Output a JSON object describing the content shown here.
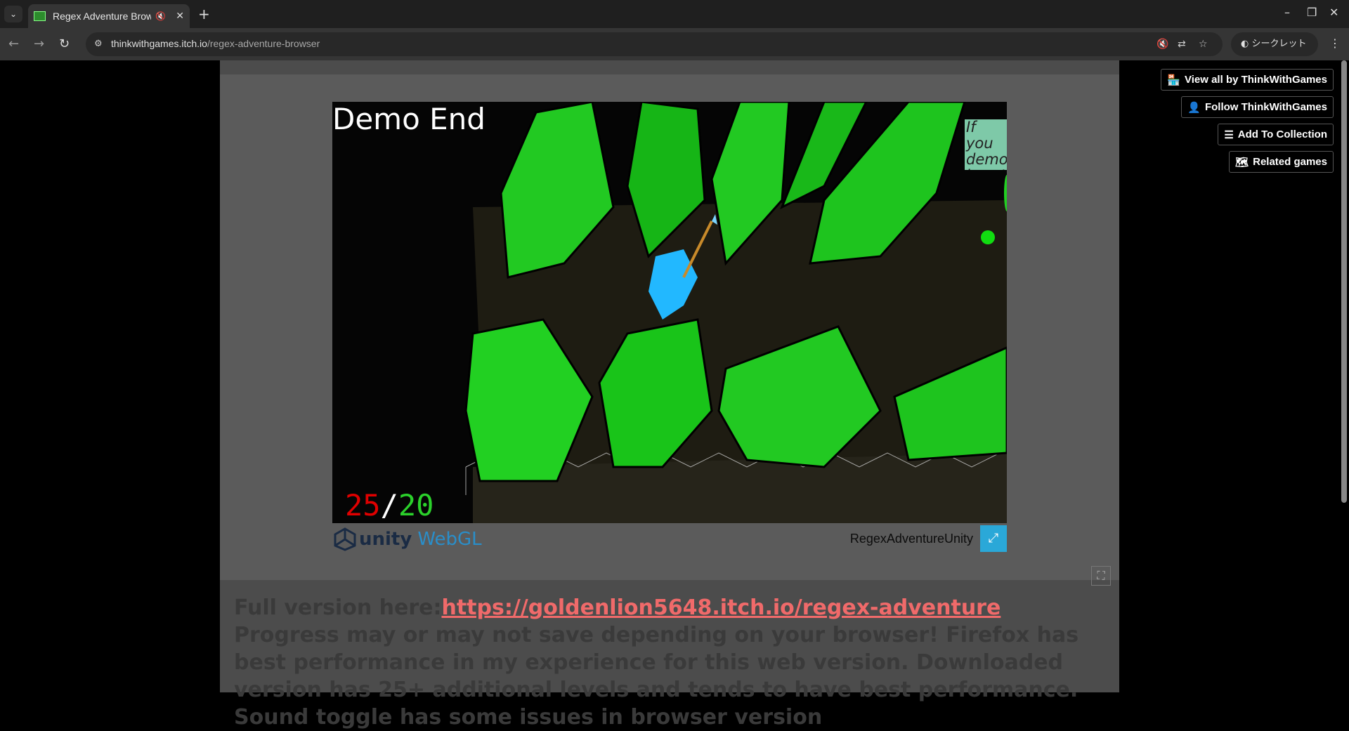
{
  "browser": {
    "tab_title": "Regex Adventure Browser",
    "url_host": "thinkwithgames.itch.io",
    "url_path": "/regex-adventure-browser",
    "incognito_label": "シークレット"
  },
  "side_buttons": [
    {
      "label": "View all by ThinkWithGames",
      "icon": "store-icon"
    },
    {
      "label": "Follow ThinkWithGames",
      "icon": "follow-user-icon"
    },
    {
      "label": "Add To Collection",
      "icon": "add-to-list-icon"
    },
    {
      "label": "Related games",
      "icon": "map-icon"
    }
  ],
  "game": {
    "overlay_title": "Demo End",
    "note_text": "If you demo, here!",
    "score_current": "25",
    "score_separator": "/",
    "score_max": "20",
    "unity_word": "unity",
    "webgl_word": "WebGL",
    "build_title": "RegexAdventureUnity"
  },
  "description": {
    "lead": "Full version here:",
    "link": "https://goldenlion5648.itch.io/regex-adventure",
    "rest": " Progress may or may not save depending on your browser! Firefox has best performance in my experience for this web version. Downloaded version has 25+ additional levels and tends to have best performance. Sound toggle has some issues in browser version"
  },
  "colors": {
    "score_current": "#e00000",
    "score_max": "#2bd12b",
    "link": "#f06a6a",
    "fullscreen_button": "#2aa8d8"
  }
}
